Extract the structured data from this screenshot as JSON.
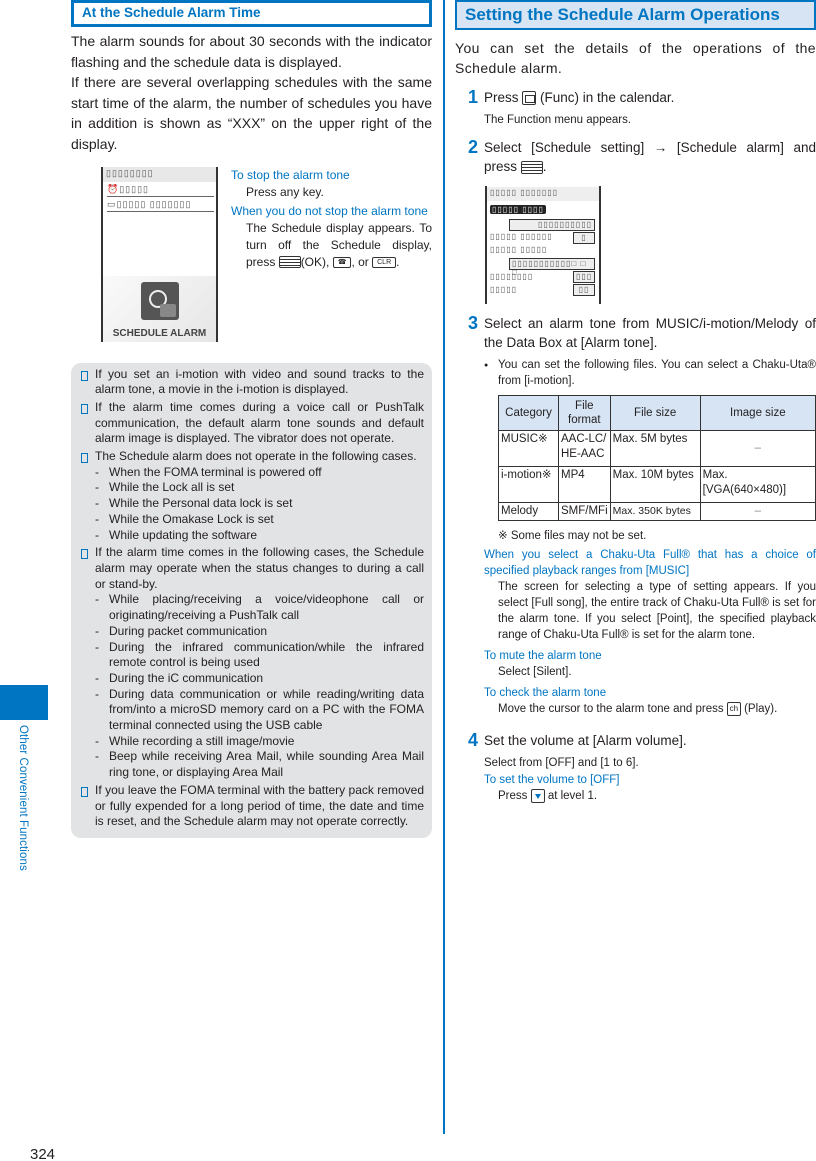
{
  "side": {
    "section_label": "Other Convenient Functions"
  },
  "page_number": "324",
  "left": {
    "heading": "At the Schedule Alarm Time",
    "paragraphs": [
      "The alarm sounds for about 30 seconds with the indicator flashing and the schedule data is displayed.",
      "If there are several overlapping schedules with the same start time of the alarm, the number of schedules you have in addition is shown as “XXX” on the upper right of the display."
    ],
    "screen": {
      "title": "▯▯▯▯▯▯▯▯",
      "line1": "▯▯▯▯▯",
      "line2": "▯▯▯▯▯ ▯▯▯▯▯▯▯",
      "alarm_label": "SCHEDULE ALARM"
    },
    "fig_notes": {
      "stop_head": "To stop the alarm tone",
      "stop_body": "Press any key.",
      "nostop_head": "When you do not stop the alarm tone",
      "nostop_body1": "The Schedule display appears. To turn off the Schedule display, press",
      "ok_label": "(OK),",
      "or_label": ", or",
      "clr_key": "CLR",
      "end": "."
    },
    "notes": [
      {
        "text": "If you set an i-motion with video and sound tracks to the alarm tone, a movie in the i-motion is displayed."
      },
      {
        "text": "If the alarm time comes during a voice call or PushTalk communication, the default alarm tone sounds and default alarm image is displayed. The vibrator does not operate."
      },
      {
        "text": "The Schedule alarm does not operate in the following cases.",
        "subs": [
          "When the FOMA terminal is powered off",
          "While the Lock all is set",
          "While the Personal data lock is set",
          "While the Omakase Lock is set",
          "While updating the software"
        ]
      },
      {
        "text": "If the alarm time comes in the following cases, the Schedule alarm may operate when the status changes to during a call or stand-by.",
        "subs": [
          "While placing/receiving a voice/videophone call or originating/receiving a PushTalk call",
          "During packet communication",
          "During the infrared communication/while the infrared remote control is being used",
          "During the iC communication",
          "During data communication or while reading/writing data from/into a microSD memory card on a PC with the FOMA terminal connected using the USB cable",
          "While recording a still image/movie",
          "Beep while receiving Area Mail, while sounding Area Mail ring tone, or displaying Area Mail"
        ]
      },
      {
        "text": "If you leave the FOMA terminal with the battery pack removed or fully expended for a long period of time, the date and time is reset, and the Schedule alarm may not operate correctly."
      }
    ]
  },
  "right": {
    "heading": "Setting the Schedule Alarm Operations",
    "intro": "You can set the details of the operations of the Schedule alarm.",
    "step1": {
      "num": "1",
      "pre": "Press",
      "post": "(Func) in the calendar.",
      "desc": "The Function menu appears."
    },
    "step2": {
      "num": "2",
      "text": "Select [Schedule setting] → [Schedule alarm] and press",
      "end": "."
    },
    "screen2": {
      "title": "▯▯▯▯▯ ▯▯▯▯▯▯▯",
      "selected": "▯▯▯▯▯ ▯▯▯▯",
      "box1": "▯▯▯▯▯▯▯▯▯▯",
      "row1": "▯▯▯▯▯ ▯▯▯▯▯▯",
      "box2": "▯",
      "row2": "▯▯▯▯▯ ▯▯▯▯▯",
      "box3": "▯▯▯▯▯▯▯▯▯▯▯□ □ □",
      "row3": "▯▯▯▯▯▯▯▯",
      "box4": "▯▯▯",
      "row4": "▯▯▯▯▯",
      "box5": "▯▯"
    },
    "step3": {
      "num": "3",
      "text": "Select an alarm tone from MUSIC/i-motion/Melody of the Data Box at [Alarm tone].",
      "bullet": "You can set the following files. You can select a Chaku-Uta® from [i-motion]."
    },
    "table": {
      "headers": [
        "Category",
        "File format",
        "File size",
        "Image size"
      ],
      "rows": [
        [
          "MUSIC※",
          "AAC-LC/ HE-AAC",
          "Max. 5M bytes",
          "–"
        ],
        [
          "i-motion※",
          "MP4",
          "Max. 10M bytes",
          "Max. [VGA(640×480)]"
        ],
        [
          "Melody",
          "SMF/MFi",
          "Max. 350K bytes",
          "–"
        ]
      ],
      "footnote": "※ Some files may not be set."
    },
    "chaku_head": "When you select a Chaku-Uta Full® that has a choice of specified playback ranges from [MUSIC]",
    "chaku_body": "The screen for selecting a type of setting appears. If you select [Full song], the entire track of Chaku-Uta Full® is set for the alarm tone. If you select [Point], the specified playback range of Chaku-Uta Full® is set for the alarm tone.",
    "mute_head": "To mute the alarm tone",
    "mute_body": "Select [Silent].",
    "check_head": "To check the alarm tone",
    "check_pre": "Move the cursor to the alarm tone and press",
    "check_key": "ch",
    "check_post": "(Play).",
    "step4": {
      "num": "4",
      "text": "Set the volume at [Alarm volume].",
      "desc": "Select from [OFF] and [1 to 6]."
    },
    "off_head": "To set the volume to [OFF]",
    "off_pre": "Press",
    "off_post": "at level 1."
  }
}
